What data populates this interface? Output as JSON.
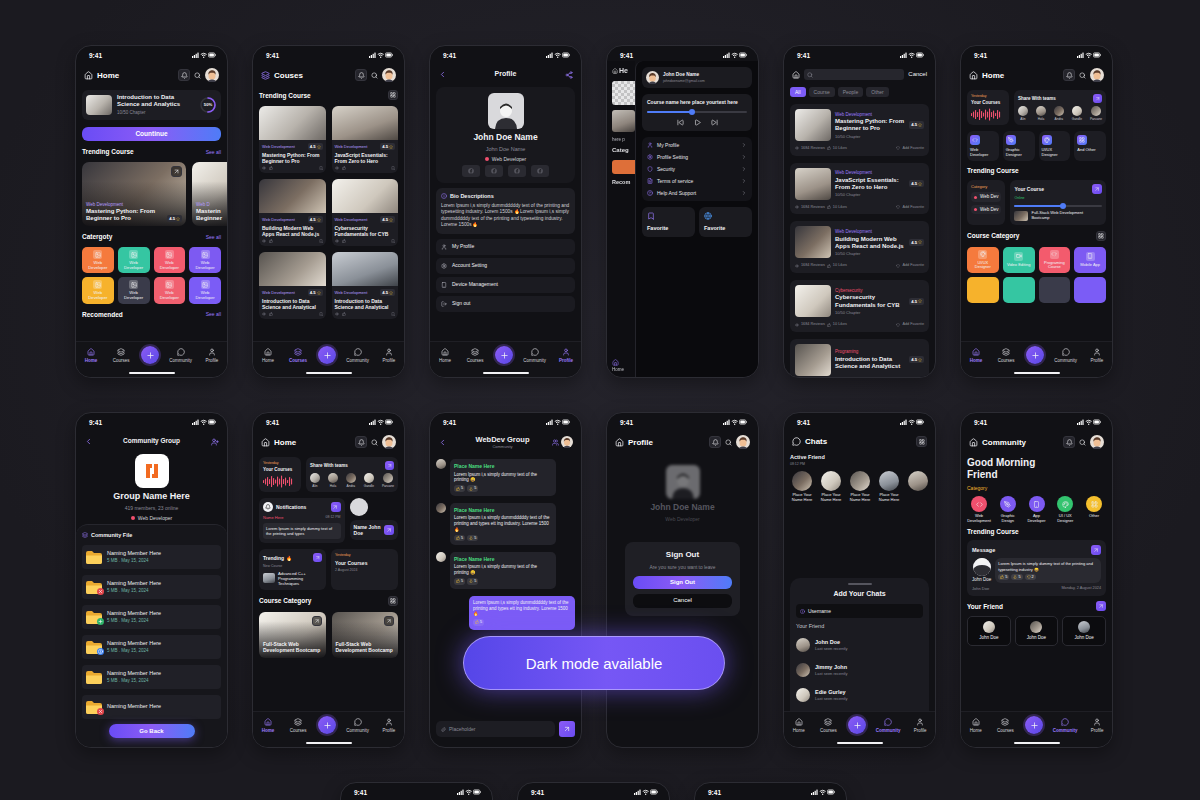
{
  "status": {
    "time": "9:41"
  },
  "promo": {
    "label": "Dark mode available"
  },
  "home": {
    "title": "Home",
    "continue": {
      "title": "Introduction to Data Science and Analytics",
      "chapter": "10/50 Chapter",
      "progress": "50%",
      "level": 0.5,
      "button": "Countinue"
    },
    "trending": {
      "title": "Trending Course",
      "link": "See all",
      "cards": [
        {
          "category": "Web Development",
          "lines": [
            "Mastering Python: From",
            "Beginner to Pro"
          ],
          "rating": "4.5"
        },
        {
          "category": "Web D",
          "lines": [
            "Masterin",
            "Beginner"
          ]
        }
      ]
    },
    "category": {
      "title": "Catergoty",
      "link": "See all",
      "tiles": [
        {
          "label": "Web Developer",
          "color": "#f57a3d"
        },
        {
          "label": "Web Developer",
          "color": "#35c6a2"
        },
        {
          "label": "Web Developer",
          "color": "#f35b6d"
        },
        {
          "label": "Web Developer",
          "color": "#7d5af2"
        },
        {
          "label": "Web Developer",
          "color": "#f6b22c"
        },
        {
          "label": "Web Developer",
          "color": "#3a3b4a"
        },
        {
          "label": "Web Developer",
          "color": "#f0606f"
        },
        {
          "label": "Web Developer",
          "color": "#7b5cf6"
        }
      ]
    },
    "recommended": {
      "title": "Recomended",
      "link": "See all"
    },
    "nav": [
      {
        "label": "Home",
        "selected": true
      },
      {
        "label": "Courses",
        "selected": false
      },
      {
        "label": "Community",
        "selected": false
      },
      {
        "label": "Profile",
        "selected": false
      }
    ]
  },
  "courses": {
    "title": "Couses",
    "section": "Trending Course",
    "cards": [
      {
        "category": "Web Development",
        "title": "Mastering Python: From Beginner to Pro",
        "rating": "4.5"
      },
      {
        "category": "Web Development",
        "title": "JavaScript Essentials: From Zero to Hero",
        "rating": "4.5"
      },
      {
        "category": "Web Development",
        "title": "Building Modern Web Apps React and Node.js",
        "rating": "4.5"
      },
      {
        "category": "Web Development",
        "title": "Cybersecurity Fundamentals for CYB",
        "rating": "4.5"
      },
      {
        "category": "Web Development",
        "title": "Introduction to Data Science and Analytical",
        "rating": "4.5"
      },
      {
        "category": "Web Development",
        "title": "Introduction to Data Science and Analytical",
        "rating": "4.5"
      }
    ],
    "nav": [
      {
        "label": "Home",
        "selected": false
      },
      {
        "label": "Courses",
        "selected": true
      },
      {
        "label": "Community",
        "selected": false
      },
      {
        "label": "Profile",
        "selected": false
      }
    ]
  },
  "profile": {
    "title": "Profile",
    "name": "John Doe Name",
    "handle": "John Doe Name",
    "role": "Web Developer",
    "bio_title": "Bio Descriptions",
    "bio": "Lorem Ipsum i,s simply dummdddddy text of the printing and typesetting industry. Lorem 1500s 🔥Lorem Ipsum i,s simply dummdddddy text of the printing and typesetting industry. Loreme 1500s🔥",
    "menu": [
      "My Profile",
      "Account Setting",
      "Device Management",
      "Sign out"
    ],
    "nav": [
      {
        "label": "Home",
        "selected": false
      },
      {
        "label": "Courses",
        "selected": false
      },
      {
        "label": "Community",
        "selected": false
      },
      {
        "label": "Profile",
        "selected": true
      }
    ]
  },
  "drawer": {
    "behind": {
      "title": "He",
      "caption": "here p",
      "section1": "Categ",
      "section2": "Recom",
      "nav": "Home"
    },
    "user": {
      "name": "John Doe Name",
      "email": "johndoename@gmail.com"
    },
    "player": {
      "title": "Course name here place yourtext here",
      "level": 0.45
    },
    "menu": [
      "My Profile",
      "Profile Setting",
      "Security",
      "Terms of service",
      "Help And Support"
    ],
    "favorites": [
      "Favorite",
      "Favorite"
    ]
  },
  "search": {
    "cancel": "Cancel",
    "filters": [
      {
        "label": "All",
        "selected": true
      },
      {
        "label": "Course",
        "selected": false
      },
      {
        "label": "People",
        "selected": false
      },
      {
        "label": "Other",
        "selected": false
      }
    ],
    "results": [
      {
        "category": "Web Development",
        "color": "#9b7bff",
        "title": "Mastering Python: From Beginner to Pro",
        "rating": "4.5",
        "chapter": "10/50 Chapter",
        "reviews": "1684 Reviews",
        "likes": "10 Likes",
        "favorite": "Add Favorite"
      },
      {
        "category": "Web Development",
        "color": "#9b7bff",
        "title": "JavaScript Essentials: From Zero to Hero",
        "rating": "4.5",
        "chapter": "10/50 Chapter",
        "reviews": "1684 Reviews",
        "likes": "10 Likes",
        "favorite": "Add Favorite"
      },
      {
        "category": "Web Development",
        "color": "#9b7bff",
        "title": "Building Modern Web Apps React and Node.js",
        "rating": "4.5",
        "chapter": "10/50 Chapter",
        "reviews": "1684 Reviews",
        "likes": "10 Likes",
        "favorite": "Add Favorite"
      },
      {
        "category": "Cybersecurity",
        "color": "#f0506e",
        "title": "Cybersecurity Fundamentals for CYB",
        "rating": "4.5",
        "chapter": "10/50 Chapter",
        "reviews": "1684 Reviews",
        "likes": "10 Likes",
        "favorite": "Add Favorite"
      },
      {
        "category": "Programing",
        "color": "#f0506e",
        "title": "Introduction to Data Science and Analyticst",
        "rating": "4.5"
      }
    ]
  },
  "home2": {
    "title": "Home",
    "overview": {
      "tag": "Yesterday",
      "label": "Your Courses"
    },
    "share": {
      "title": "Share With teams",
      "people": [
        "Alin",
        "Hola",
        "Andra",
        "Gandle",
        "Paruane"
      ]
    },
    "tiles": [
      "Web Developer",
      "Graphic Designer",
      "UI/UX Designer",
      "And Other"
    ],
    "trending": "Trending Course",
    "category_card": {
      "tag": "Category",
      "items": [
        "Web Dev",
        "Web Dev"
      ]
    },
    "course_card": {
      "title": "Your Course",
      "status": "Online",
      "level": 0.55,
      "name": "Full-Stack Web Development Bootcamp"
    },
    "course_category": {
      "title": "Course Category",
      "tiles": [
        {
          "label": "UI/UX Designer",
          "color": "#f57a3d"
        },
        {
          "label": "Video Editing",
          "color": "#35c6a2"
        },
        {
          "label": "Programing Course",
          "color": "#f35b6d"
        },
        {
          "label": "Mobile App",
          "color": "#7d5af2"
        }
      ],
      "more": [
        {
          "color": "#f6b22c"
        },
        {
          "color": "#35c6a2"
        },
        {
          "color": "#3a3b4a"
        },
        {
          "color": "#7b5cf6"
        }
      ]
    },
    "nav": [
      {
        "label": "Home",
        "selected": true
      },
      {
        "label": "Courses",
        "selected": false
      },
      {
        "label": "Community",
        "selected": false
      },
      {
        "label": "Profile",
        "selected": false
      }
    ]
  },
  "group": {
    "title": "Community Group",
    "name": "Group Name Here",
    "members": "419 members, 23 online",
    "role": "Web Developer",
    "files_title": "Community File",
    "files": [
      {
        "name": "Naming Member Here",
        "meta": "5 MB . May 15, 2024",
        "kind": "plain"
      },
      {
        "name": "Naming Member Here",
        "meta": "5 MB . May 15, 2024",
        "kind": "remove"
      },
      {
        "name": "Naming Member Here",
        "meta": "5 MB . May 15, 2024",
        "kind": "add"
      },
      {
        "name": "Naming Member Here",
        "meta": "5 MB . May 15, 2024",
        "kind": "info"
      },
      {
        "name": "Naming Member Here",
        "meta": "5 MB . May 15, 2024",
        "kind": "plain"
      },
      {
        "name": "Naming Member Here",
        "kind": "remove"
      }
    ],
    "button": "Go Back"
  },
  "home3": {
    "title": "Home",
    "overview": {
      "tag": "Yesterday",
      "label": "Your Courses"
    },
    "share": {
      "title": "Share With teams",
      "people": [
        "Alin",
        "Hola",
        "Andra",
        "Gandle",
        "Paruane"
      ]
    },
    "notifications": {
      "title": "Notifications",
      "sender": "Name Here",
      "time": "08:12 PM",
      "text": "Lorem Ipsum is simply dummy text of the printing and types"
    },
    "contact": {
      "title": "Name John Doe"
    },
    "trending": {
      "title": "Trending 🔥",
      "tag": "New Course",
      "name": "Advanced C++ Programming Techniques"
    },
    "your_courses": {
      "tag": "Yesterday",
      "title": "Your Courses",
      "date": "2 August 2024"
    },
    "course_category": "Course Category",
    "cards": [
      "Full-Stack Web Development Bootcamp",
      "Full-Stack Web Development Bootcamp"
    ],
    "nav": [
      {
        "label": "Home",
        "selected": true
      },
      {
        "label": "Courses",
        "selected": false
      },
      {
        "label": "Community",
        "selected": false
      },
      {
        "label": "Profile",
        "selected": false
      }
    ]
  },
  "chat": {
    "title": "WebDev Group",
    "subtitle": "Community",
    "messages": [
      {
        "kind": "incoming",
        "author": "Place Name Here",
        "text": "Lorem Ipsum i,s simply dummy text of the printing 😄",
        "reactions": [
          "5",
          "5"
        ]
      },
      {
        "kind": "incoming",
        "author": "Place Name Here",
        "text": "Lorem Ipsum i,s simply dummdddddy text of the printing and types ett ing industry. Loreme 1500 🔥",
        "reactions": [
          "5",
          "5"
        ]
      },
      {
        "kind": "incoming",
        "author": "Place Name Here",
        "text": "Lorem Ipsum i,s simply dummy text of the printing 😄",
        "reactions": [
          "5",
          "5"
        ]
      },
      {
        "kind": "outgoing",
        "text": "Lorem Ipsum i,s simply dummdddddy text of the printing and types ett ing industry. Loreme 1500 🔥",
        "reactions": [
          "5"
        ]
      }
    ],
    "input": "Placeholder"
  },
  "signout": {
    "title": "Profile",
    "name": "John Doe Name",
    "role": "Web Developer",
    "dialog": {
      "title": "Sign Out",
      "message": "Are you sure you want to leave",
      "confirm": "Sign Out",
      "cancel": "Cancel"
    }
  },
  "chats": {
    "title": "Chats",
    "active": "Active Friend",
    "time": "08:12 PM",
    "friends": [
      "Place Your Name Here",
      "Place Your Name Here",
      "Place Your Name Here",
      "Place Your Name Here"
    ],
    "sheet": {
      "title": "Add Your Chats",
      "field": "Username",
      "section": "Your Friend",
      "people": [
        {
          "name": "John Doe",
          "status": "Last seen recently"
        },
        {
          "name": "Jimmy John",
          "status": "Last seen recently"
        },
        {
          "name": "Edie Gurley",
          "status": "Last seen recently"
        }
      ]
    },
    "nav": [
      {
        "label": "Home",
        "selected": false
      },
      {
        "label": "Courses",
        "selected": false
      },
      {
        "label": "Community",
        "selected": true
      },
      {
        "label": "Profile",
        "selected": false
      }
    ]
  },
  "community": {
    "title": "Community",
    "greeting": "Good Morning Friend",
    "category": "Category",
    "categories": [
      {
        "label": "Web Development",
        "color": "#f0506e"
      },
      {
        "label": "Graphic Design",
        "color": "#7d5af2"
      },
      {
        "label": "App Developer",
        "color": "#7d5af2"
      },
      {
        "label": "UI / UX Designer",
        "color": "#33c46f"
      },
      {
        "label": "Other",
        "color": "#f5c02e"
      }
    ],
    "trending": "Trending Course",
    "message": {
      "title": "Message",
      "author": "John Doe",
      "text": "Lorem Ipsum is simply dummy text of the printing and typesetting industry 😄",
      "reactions": [
        "5",
        "5",
        "2"
      ],
      "caption": "John Doe",
      "date": "Monday, 2 August 2024"
    },
    "friends_title": "Your Friend",
    "friends": [
      "John Doe",
      "John Doe",
      "John Doe"
    ],
    "nav": [
      {
        "label": "Home",
        "selected": false
      },
      {
        "label": "Courses",
        "selected": false
      },
      {
        "label": "Community",
        "selected": true
      },
      {
        "label": "Profile",
        "selected": false
      }
    ]
  }
}
